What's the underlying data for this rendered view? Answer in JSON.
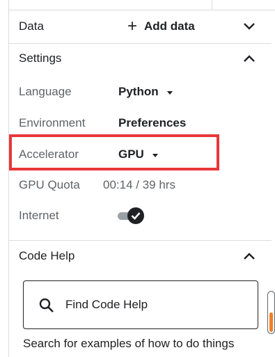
{
  "data_section": {
    "title": "Data",
    "add_label": "Add data",
    "add_icon": "+"
  },
  "settings": {
    "title": "Settings",
    "rows": {
      "language": {
        "label": "Language",
        "value": "Python"
      },
      "environment": {
        "label": "Environment",
        "value": "Preferences"
      },
      "accelerator": {
        "label": "Accelerator",
        "value": "GPU"
      },
      "gpu_quota": {
        "label": "GPU Quota",
        "value": "00:14 / 39 hrs"
      },
      "internet": {
        "label": "Internet",
        "enabled": true
      }
    }
  },
  "code_help": {
    "title": "Code Help",
    "search_placeholder": "Find Code Help",
    "description": "Search for examples of how to do things"
  },
  "colors": {
    "highlight": "#e8373a",
    "scroll_thumb": "#f07f25"
  }
}
